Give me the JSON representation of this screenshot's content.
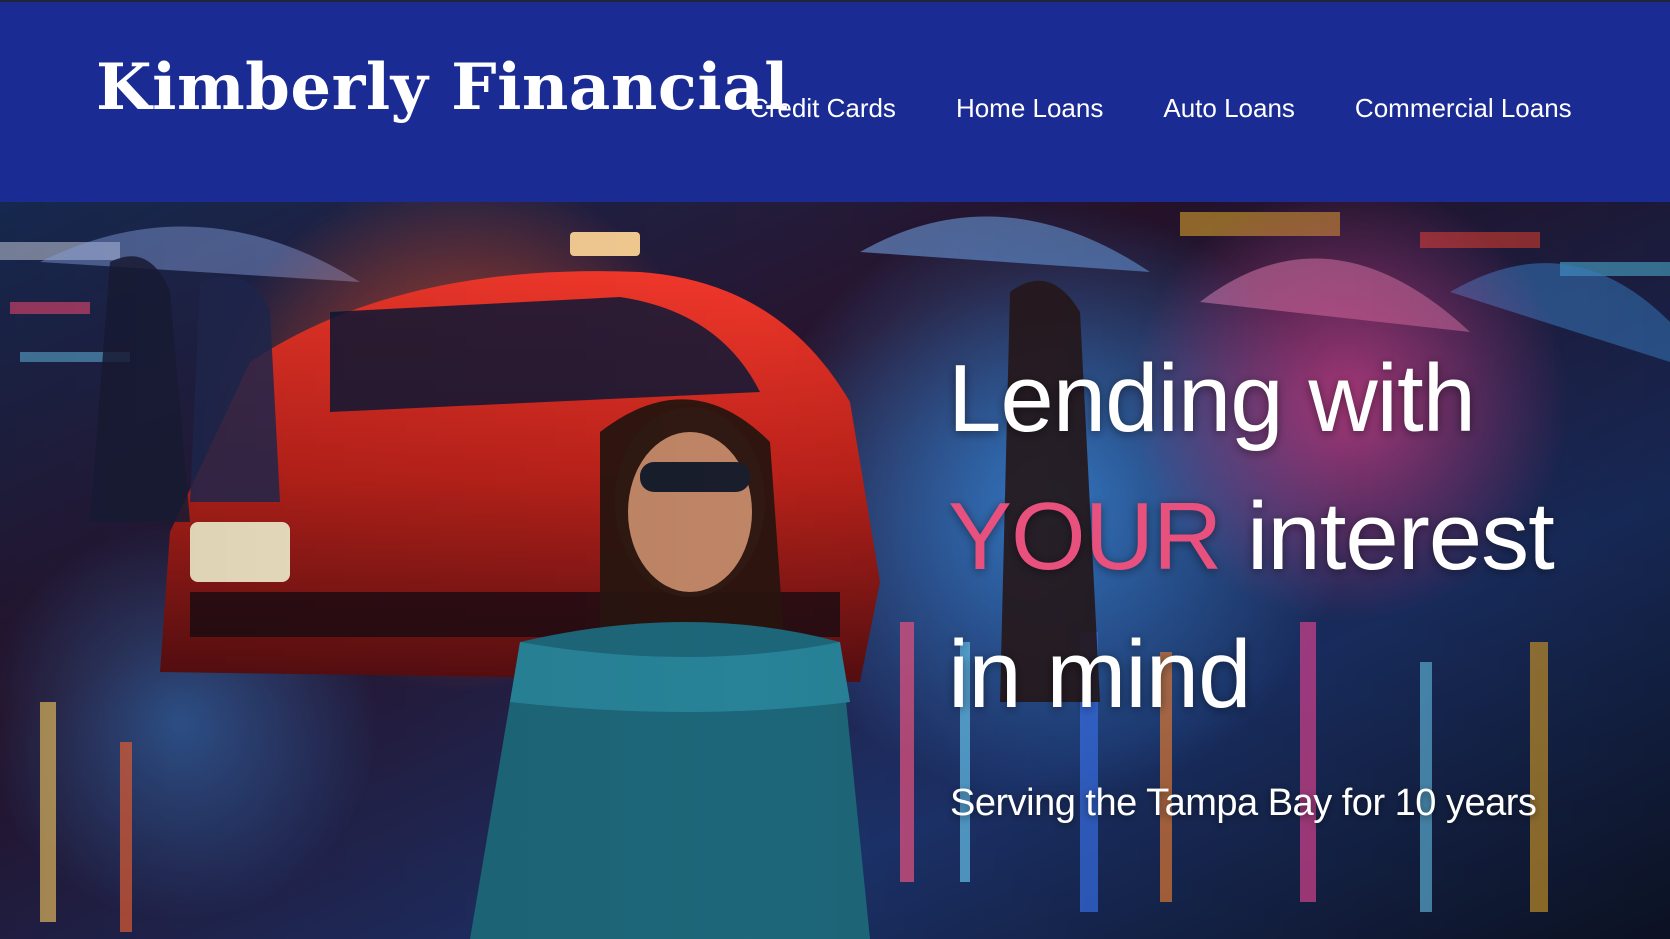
{
  "header": {
    "brand": "Kimberly Financial",
    "nav": [
      {
        "label": "Credit Cards"
      },
      {
        "label": "Home Loans"
      },
      {
        "label": "Auto Loans"
      },
      {
        "label": "Commercial Loans"
      }
    ]
  },
  "hero": {
    "headline_line1": "Lending with",
    "headline_accent": "YOUR",
    "headline_line2_rest": "interest",
    "headline_line3": "in mind",
    "subheadline": "Serving the Tampa Bay for 10 years",
    "image_description_icon": "street-mural-photo"
  },
  "colors": {
    "header_background": "#1b2b94",
    "accent": "#e8507e",
    "text": "#ffffff"
  }
}
